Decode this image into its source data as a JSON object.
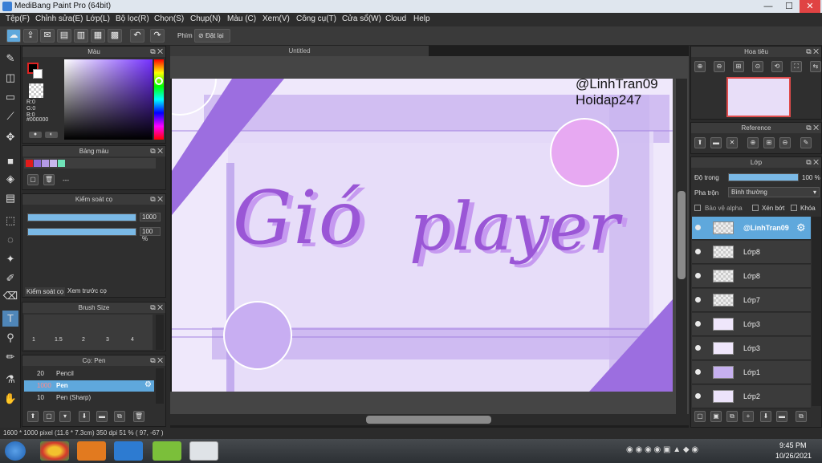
{
  "window": {
    "title": "MediBang Paint Pro (64bit)",
    "minimize": "—",
    "maximize": "☐",
    "close": "✕"
  },
  "menu": [
    "Tệp(F)",
    "Chỉnh sửa(E)",
    "Lớp(L)",
    "Bộ lọc(R)",
    "Chọn(S)",
    "Chụp(N)",
    "Màu (C)",
    "Xem(V)",
    "Công cụ(T)",
    "Cửa sổ(W)",
    "Cloud",
    "Help"
  ],
  "toolbar": {
    "key_label": "Phím",
    "reset_label": "Đặt lại"
  },
  "color_panel": {
    "title": "Màu",
    "r": "R:0",
    "g": "G:0",
    "b": "B:0",
    "hex": "#000000"
  },
  "palette_panel": {
    "title": "Bảng màu",
    "swatches": [
      "#e11b1b",
      "#8d6bd8",
      "#b49ae6",
      "#c9b8ef",
      "#6fe3b8"
    ],
    "dash": "---"
  },
  "brush_control": {
    "title": "Kiểm soát cọ",
    "size_value": "1000",
    "opacity_value": "100 %",
    "tab1": "Kiểm soát cọ",
    "tab2": "Xem trước cọ"
  },
  "brush_size": {
    "title": "Brush Size",
    "sizes": [
      "1",
      "1.5",
      "2",
      "3",
      "4"
    ]
  },
  "brush_list": {
    "title": "Cọ: Pen",
    "items": [
      {
        "size": "20",
        "name": "Pencil"
      },
      {
        "size": "1000",
        "name": "Pen"
      },
      {
        "size": "10",
        "name": "Pen (Sharp)"
      }
    ]
  },
  "document": {
    "tab": "Untitled"
  },
  "canvas": {
    "watermark1": "@LinhTran09",
    "watermark2": "Hoidap247",
    "art_text1": "Gió",
    "art_text2": "player"
  },
  "navigator": {
    "title": "Hoa tiêu"
  },
  "reference": {
    "title": "Reference"
  },
  "layer_panel": {
    "title": "Lớp",
    "opacity_label": "Độ trong",
    "opacity_value": "100 %",
    "blend_label": "Pha trộn",
    "blend_value": "Bình thường",
    "protect_alpha": "Bảo vệ alpha",
    "clip": "Xén bớt",
    "lock": "Khóa",
    "layers": [
      "@LinhTran09",
      "Lớp8",
      "Lớp8",
      "Lớp7",
      "Lớp3",
      "Lớp3",
      "Lớp1",
      "Lớp2"
    ]
  },
  "status": {
    "text": "1600 * 1000 pixel   (11.6 * 7.3cm)   350 dpi   51 %   ( 97, -67 )"
  },
  "taskbar": {
    "time": "9:45 PM",
    "date": "10/26/2021"
  }
}
